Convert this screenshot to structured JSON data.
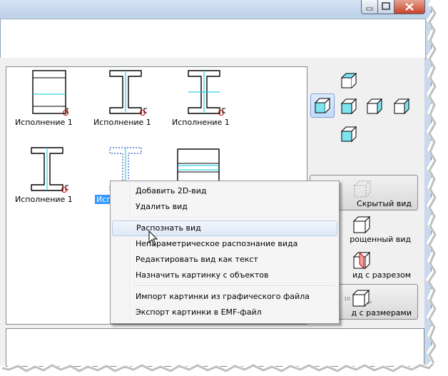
{
  "window": {
    "minimize_icon": "minimize-icon",
    "maximize_icon": "maximize-icon",
    "close_icon": "close-icon"
  },
  "gallery": {
    "items": [
      {
        "label": "Исполнение 1",
        "shape": "plain-rect",
        "selected": false
      },
      {
        "label": "Исполнение 1",
        "shape": "i-beam",
        "selected": false
      },
      {
        "label": "Исполнение 1",
        "shape": "i-beam",
        "selected": false
      },
      {
        "label": "Исполнение 1",
        "shape": "i-beam",
        "selected": false
      },
      {
        "label": "Исп",
        "shape": "i-beam-dashed",
        "selected": true
      },
      {
        "label": "",
        "shape": "striped-rect",
        "selected": false
      }
    ]
  },
  "orientation": {
    "buttons": [
      "view-top",
      "view-front",
      "view-left",
      "view-iso",
      "view-right",
      "view-back",
      "view-bottom"
    ]
  },
  "modes": {
    "hidden": "Скрытый вид",
    "simplified": "рощенный вид",
    "section": "ид с разрезом",
    "dimensions": "д с размерами"
  },
  "context_menu": {
    "items": [
      {
        "label": "Добавить 2D-вид"
      },
      {
        "label": "Удалить вид"
      },
      {
        "label": "Распознать вид",
        "highlighted": true
      },
      {
        "label": "Непараметрическое распознание вида"
      },
      {
        "label": "Редактировать вид как текст"
      },
      {
        "label": "Назначить картинку с объектов"
      },
      {
        "label": "Импорт картинки из графического файла"
      },
      {
        "label": "Экспорт картинки в EMF-файл"
      }
    ]
  },
  "colors": {
    "accent": "#3399ff",
    "cyan": "#00c8e0",
    "menu_highlight": "#dde9f7"
  }
}
